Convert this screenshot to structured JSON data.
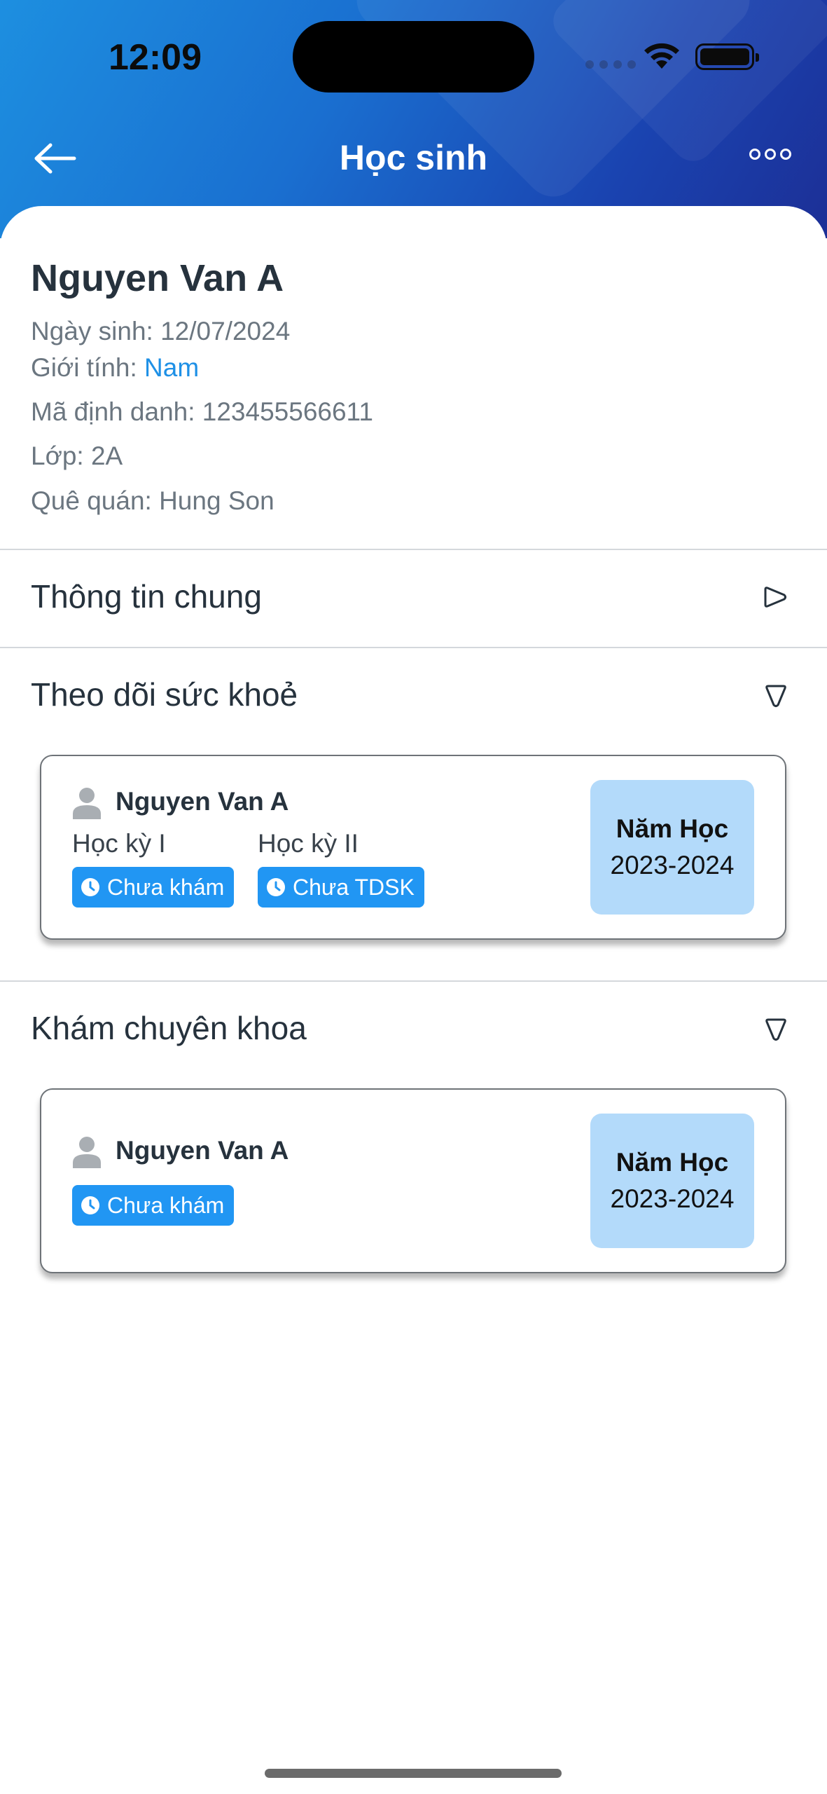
{
  "status_bar": {
    "time": "12:09"
  },
  "header": {
    "title": "Học sinh"
  },
  "student": {
    "name": "Nguyen Van A",
    "dob": "Ngày sinh: 12/07/2024",
    "gender_label": "Giới tính: ",
    "gender_value": "Nam",
    "id_code": "Mã định danh: 123455566611",
    "class": "Lớp: 2A",
    "hometown": "Quê quán: Hung Son"
  },
  "sections": {
    "general": {
      "title": "Thông tin chung"
    },
    "health": {
      "title": "Theo dõi sức khoẻ",
      "card": {
        "name": "Nguyen Van A",
        "term1_label": "Học kỳ I",
        "term2_label": "Học kỳ II",
        "term1_status": "Chưa khám",
        "term2_status": "Chưa TDSK",
        "year_label": "Năm Học",
        "year_value": "2023-2024"
      }
    },
    "specialist": {
      "title": "Khám chuyên khoa",
      "card": {
        "name": "Nguyen Van A",
        "status": "Chưa khám",
        "year_label": "Năm Học",
        "year_value": "2023-2024"
      }
    }
  },
  "colors": {
    "accent": "#1e90e6",
    "badge": "#2196f3",
    "year_box": "#b3dafa"
  },
  "icons": [
    "back-arrow-icon",
    "more-options-icon",
    "chevron-right-icon",
    "chevron-down-icon",
    "person-icon",
    "clock-icon",
    "wifi-icon",
    "battery-icon"
  ]
}
